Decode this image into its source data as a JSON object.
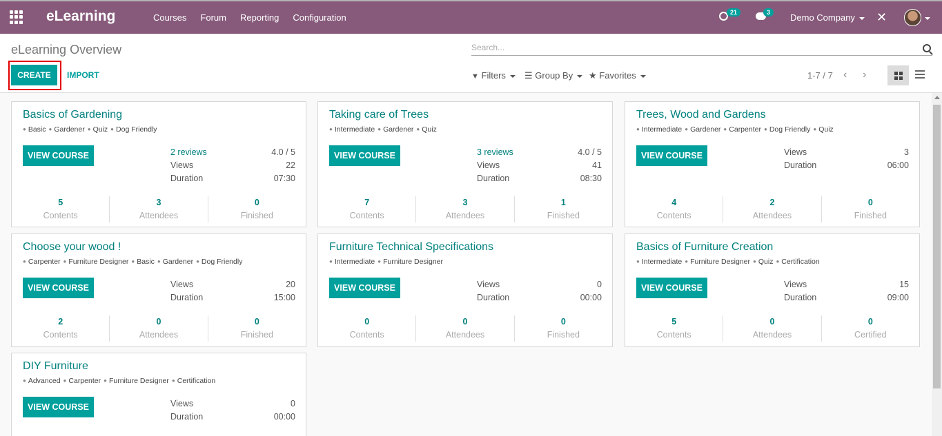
{
  "navbar": {
    "brand": "eLearning",
    "menu": [
      "Courses",
      "Forum",
      "Reporting",
      "Configuration"
    ],
    "activity_count": "21",
    "messages_count": "3",
    "company": "Demo Company"
  },
  "control": {
    "breadcrumb": "eLearning Overview",
    "search_placeholder": "Search...",
    "create": "CREATE",
    "import": "IMPORT",
    "filters": "Filters",
    "group_by": "Group By",
    "favorites": "Favorites",
    "pager": "1-7 / 7"
  },
  "cards": [
    {
      "title": "Basics of Gardening",
      "tags": [
        "Basic",
        "Gardener",
        "Quiz",
        "Dog Friendly"
      ],
      "button": "VIEW COURSE",
      "reviews": "2 reviews",
      "rating": "4.0 / 5",
      "views_label": "Views",
      "views": "22",
      "duration_label": "Duration",
      "duration": "07:30",
      "c1": "5",
      "c1_label": "Contents",
      "c2": "3",
      "c2_label": "Attendees",
      "c3": "0",
      "c3_label": "Finished"
    },
    {
      "title": "Taking care of Trees",
      "tags": [
        "Intermediate",
        "Gardener",
        "Quiz"
      ],
      "button": "VIEW COURSE",
      "reviews": "3 reviews",
      "rating": "4.0 / 5",
      "views_label": "Views",
      "views": "41",
      "duration_label": "Duration",
      "duration": "08:30",
      "c1": "7",
      "c1_label": "Contents",
      "c2": "3",
      "c2_label": "Attendees",
      "c3": "1",
      "c3_label": "Finished"
    },
    {
      "title": "Trees, Wood and Gardens",
      "tags": [
        "Intermediate",
        "Gardener",
        "Carpenter",
        "Dog Friendly",
        "Quiz"
      ],
      "button": "VIEW COURSE",
      "views_label": "Views",
      "views": "3",
      "duration_label": "Duration",
      "duration": "06:00",
      "c1": "4",
      "c1_label": "Contents",
      "c2": "2",
      "c2_label": "Attendees",
      "c3": "0",
      "c3_label": "Finished"
    },
    {
      "title": "Choose your wood !",
      "tags": [
        "Carpenter",
        "Furniture Designer",
        "Basic",
        "Gardener",
        "Dog Friendly"
      ],
      "button": "VIEW COURSE",
      "views_label": "Views",
      "views": "20",
      "duration_label": "Duration",
      "duration": "15:00",
      "c1": "2",
      "c1_label": "Contents",
      "c2": "0",
      "c2_label": "Attendees",
      "c3": "0",
      "c3_label": "Finished"
    },
    {
      "title": "Furniture Technical Specifications",
      "tags": [
        "Intermediate",
        "Furniture Designer"
      ],
      "button": "VIEW COURSE",
      "views_label": "Views",
      "views": "0",
      "duration_label": "Duration",
      "duration": "00:00",
      "c1": "0",
      "c1_label": "Contents",
      "c2": "0",
      "c2_label": "Attendees",
      "c3": "0",
      "c3_label": "Finished"
    },
    {
      "title": "Basics of Furniture Creation",
      "tags": [
        "Intermediate",
        "Furniture Designer",
        "Quiz",
        "Certification"
      ],
      "button": "VIEW COURSE",
      "views_label": "Views",
      "views": "15",
      "duration_label": "Duration",
      "duration": "09:00",
      "c1": "5",
      "c1_label": "Contents",
      "c2": "0",
      "c2_label": "Attendees",
      "c3": "0",
      "c3_label": "Certified"
    },
    {
      "title": "DIY Furniture",
      "tags": [
        "Advanced",
        "Carpenter",
        "Furniture Designer",
        "Certification"
      ],
      "button": "VIEW COURSE",
      "views_label": "Views",
      "views": "0",
      "duration_label": "Duration",
      "duration": "00:00"
    }
  ]
}
